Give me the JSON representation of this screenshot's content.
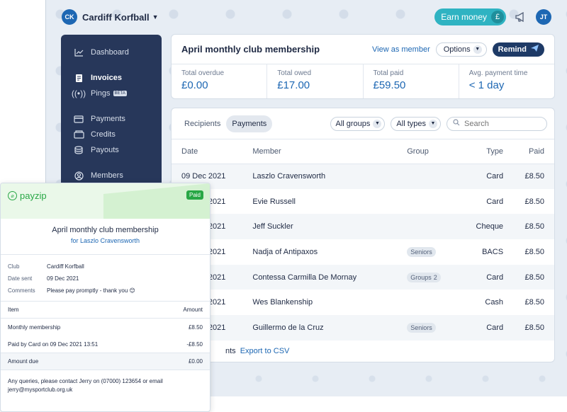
{
  "topbar": {
    "club_initials": "CK",
    "club_name": "Cardiff Korfball",
    "earn_money_label": "Earn money",
    "earn_icon_glyph": "£",
    "user_initials": "JT"
  },
  "sidebar": {
    "items": [
      {
        "label": "Dashboard",
        "icon": "chart-icon"
      },
      {
        "label": "Invoices",
        "icon": "invoice-icon"
      },
      {
        "label": "Pings",
        "icon": "ping-icon",
        "badge": "BETA"
      },
      {
        "label": "Payments",
        "icon": "card-icon"
      },
      {
        "label": "Credits",
        "icon": "credits-icon"
      },
      {
        "label": "Payouts",
        "icon": "coins-icon"
      },
      {
        "label": "Members",
        "icon": "user-icon"
      }
    ]
  },
  "header": {
    "title": "April monthly club membership",
    "view_as_member": "View as member",
    "options_label": "Options",
    "remind_label": "Remind",
    "stats": [
      {
        "label": "Total overdue",
        "value": "£0.00"
      },
      {
        "label": "Total owed",
        "value": "£17.00"
      },
      {
        "label": "Total paid",
        "value": "£59.50"
      },
      {
        "label": "Avg. payment time",
        "value": "< 1 day"
      }
    ]
  },
  "payments": {
    "tabs": [
      "Recipients",
      "Payments"
    ],
    "filter_groups": "All groups",
    "filter_types": "All types",
    "search_placeholder": "Search",
    "columns": [
      "Date",
      "Member",
      "Group",
      "Type",
      "Paid"
    ],
    "rows": [
      {
        "date": "09 Dec 2021",
        "member": "Laszlo Cravensworth",
        "group": "",
        "group_count": "",
        "type": "Card",
        "paid": "£8.50"
      },
      {
        "date": "09 Dec 2021",
        "member": "Evie Russell",
        "group": "",
        "group_count": "",
        "type": "Card",
        "paid": "£8.50"
      },
      {
        "date": "09 Dec 2021",
        "member": "Jeff Suckler",
        "group": "",
        "group_count": "",
        "type": "Cheque",
        "paid": "£8.50"
      },
      {
        "date": "09 Dec 2021",
        "member": "Nadja of Antipaxos",
        "group": "Seniors",
        "group_count": "",
        "type": "BACS",
        "paid": "£8.50"
      },
      {
        "date": "09 Dec 2021",
        "member": "Contessa Carmilla De Mornay",
        "group": "Groups",
        "group_count": "2",
        "type": "Card",
        "paid": "£8.50"
      },
      {
        "date": "09 Dec 2021",
        "member": "Wes Blankenship",
        "group": "",
        "group_count": "",
        "type": "Cash",
        "paid": "£8.50"
      },
      {
        "date": "09 Dec 2021",
        "member": "Guillermo de la Cruz",
        "group": "Seniors",
        "group_count": "",
        "type": "Card",
        "paid": "£8.50"
      }
    ],
    "footer_partial": "nts",
    "export_label": "Export to CSV"
  },
  "receipt": {
    "brand": "payzip",
    "status": "Paid",
    "title": "April monthly club membership",
    "subtitle": "for Laszlo Cravensworth",
    "meta": [
      {
        "key": "Club",
        "value": "Cardiff Korfball"
      },
      {
        "key": "Date sent",
        "value": "09 Dec 2021"
      },
      {
        "key": "Comments",
        "value": "Please pay promptly - thank you 😊"
      }
    ],
    "item_header": {
      "item": "Item",
      "amount": "Amount"
    },
    "items": [
      {
        "item": "Monthly membership",
        "amount": "£8.50"
      },
      {
        "item": "Paid by Card on 09 Dec 2021 13:51",
        "amount": "-£8.50"
      }
    ],
    "amount_due": {
      "item": "Amount due",
      "amount": "£0.00"
    },
    "footer": "Any queries, please contact Jerry on (07000) 123654 or email jerry@mysportclub.org.uk"
  }
}
